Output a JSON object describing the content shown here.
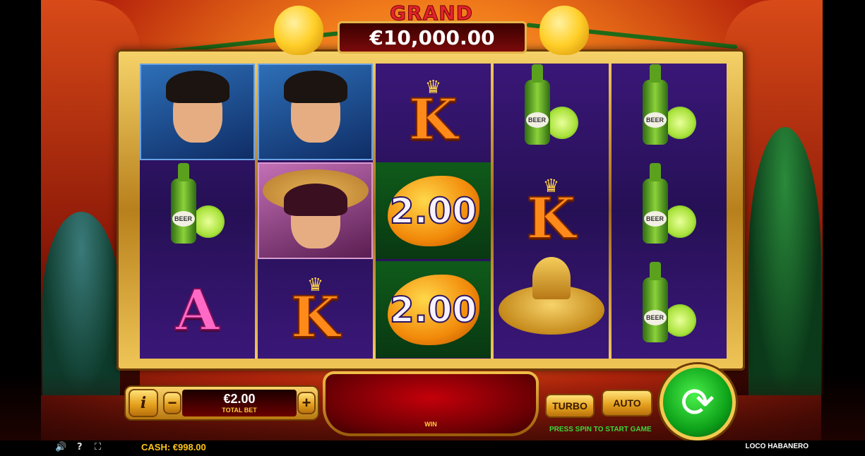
{
  "jackpot": {
    "title": "GRAND",
    "value": "€10,000.00"
  },
  "reels": [
    [
      {
        "symbol": "mariachi-man"
      },
      {
        "symbol": "beer-lime",
        "label": "BEER"
      },
      {
        "symbol": "letter-a",
        "label": "A"
      }
    ],
    [
      {
        "symbol": "mariachi-man"
      },
      {
        "symbol": "senorita"
      },
      {
        "symbol": "letter-k",
        "label": "K"
      }
    ],
    [
      {
        "symbol": "letter-k",
        "label": "K"
      },
      {
        "symbol": "chili-value",
        "label": "2.00"
      },
      {
        "symbol": "chili-value",
        "label": "2.00"
      }
    ],
    [
      {
        "symbol": "beer-lime",
        "label": "BEER"
      },
      {
        "symbol": "letter-k",
        "label": "K"
      },
      {
        "symbol": "sombrero"
      }
    ],
    [
      {
        "symbol": "beer-lime",
        "label": "BEER"
      },
      {
        "symbol": "beer-lime",
        "label": "BEER"
      },
      {
        "symbol": "beer-lime",
        "label": "BEER"
      }
    ]
  ],
  "controls": {
    "info_label": "i",
    "minus_label": "−",
    "plus_label": "+",
    "bet_value": "€2.00",
    "bet_label": "TOTAL BET",
    "win_label": "WIN",
    "turbo_label": "TURBO",
    "auto_label": "AUTO",
    "spin_hint": "PRESS SPIN TO START GAME"
  },
  "footer": {
    "sound_icon": "speaker-icon",
    "help_label": "?",
    "fullscreen_icon": "fullscreen-icon",
    "cash_text": "CASH:  €998.00",
    "game_name": "LOCO HABANERO"
  },
  "colors": {
    "accent_gold": "#f3c94e",
    "spin_green": "#0ea21a",
    "cash_yellow": "#ffc419",
    "grand_red": "#e5232b"
  }
}
